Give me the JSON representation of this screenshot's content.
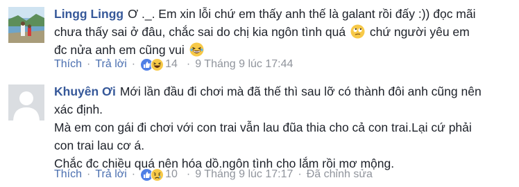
{
  "comments": [
    {
      "author": "Lingg Lingg",
      "line1_a": "Ơ ._. Em xin lỗi chứ em thấy anh thế là galant rồi đấy :)) đọc mãi",
      "line2_a": "chưa thấy sai ở đâu, chắc sai do chị kia ngôn tình quá",
      "line2_b": "chứ người yêu em",
      "line3_a": "đc nửa anh em cũng vui",
      "like_label": "Thích",
      "reply_label": "Trả lời",
      "reaction_count": "14",
      "timestamp": "9 Tháng 9 lúc 17:44",
      "reactions": [
        "like-icon",
        "haha-icon"
      ],
      "inline_emojis": [
        "rolling-eyes-emoji",
        "laughing-emoji"
      ]
    },
    {
      "author": "Khuyên Ơi",
      "line1_a": "Mới lần đầu đi chơi mà đã thế thì sau lỡ có thành đôi anh cũng nên",
      "line2": "xác định.",
      "line3": "Mà em con gái đi chơi với con trai vẫn lau đũa thia cho cả con trai.Lại cứ phải",
      "line4": "con trai lau cơ á.",
      "line5": "Chắc đc chiều quá nên hóa dồ.ngôn tình cho lắm rồi mơ mộng.",
      "like_label": "Thích",
      "reply_label": "Trả lời",
      "reaction_count": "10",
      "timestamp": "9 Tháng 9 lúc 17:17",
      "edited_label": "Đã chỉnh sửa",
      "reactions": [
        "like-icon",
        "sad-icon"
      ]
    }
  ],
  "colors": {
    "author": "#365899",
    "link": "#4b6fb0",
    "meta": "#90949c",
    "text": "#1d2129"
  }
}
